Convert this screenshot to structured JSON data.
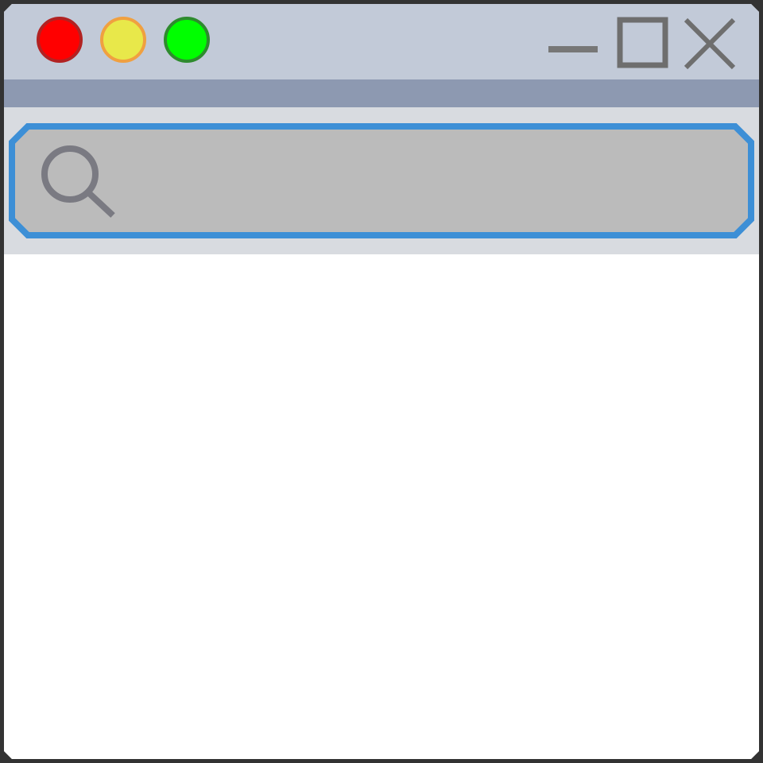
{
  "window": {
    "traffic_lights": [
      {
        "name": "close",
        "color": "#ff0000",
        "border": "#b22222"
      },
      {
        "name": "minimize",
        "color": "#e8e84a",
        "border": "#f0a040"
      },
      {
        "name": "zoom",
        "color": "#00ff00",
        "border": "#2e8b2e"
      }
    ],
    "controls": [
      "minimize-icon",
      "maximize-icon",
      "close-icon"
    ],
    "colors": {
      "titlebar": "#c2cad8",
      "toolbar_strip": "#8d99b1",
      "search_area": "#d8dbe0",
      "search_field": "#bbbbbb",
      "search_border": "#3d8fd6",
      "icon_gray": "#777777"
    }
  },
  "search": {
    "value": "",
    "placeholder": "",
    "icon": "search-icon"
  }
}
